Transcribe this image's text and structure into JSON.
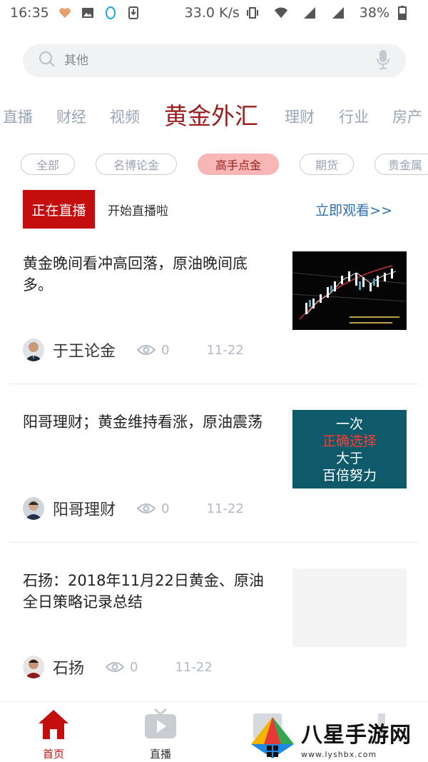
{
  "status_bar": {
    "time": "16:35",
    "speed": "33.0 K/s",
    "battery": "38%"
  },
  "search": {
    "placeholder": "其他"
  },
  "categories": [
    "直播",
    "财经",
    "视频",
    "黄金外汇",
    "理财",
    "行业",
    "房产"
  ],
  "active_category": "黄金外汇",
  "tags": [
    "全部",
    "名博论金",
    "高手点金",
    "期货",
    "贵金属"
  ],
  "active_tag": "高手点金",
  "live": {
    "badge": "正在直播",
    "text": "开始直播啦",
    "link": "立即观看>>"
  },
  "articles": [
    {
      "title": "黄金晚间看冲高回落，原油晚间底多。",
      "author": "于王论金",
      "views": "0",
      "date": "11-22",
      "thumb": "chart"
    },
    {
      "title": "阳哥理财；黄金维持看涨，原油震荡",
      "author": "阳哥理财",
      "views": "0",
      "date": "11-22",
      "thumb": "text",
      "thumb_lines": [
        "一次",
        "正确选择",
        "大于",
        "百倍努力"
      ]
    },
    {
      "title": "石扬：2018年11月22日黄金、原油全日策略记录总结",
      "author": "石扬",
      "views": "0",
      "date": "11-22",
      "thumb": "blank"
    }
  ],
  "tab_bar": {
    "home_label": "首页",
    "live_label": "直播"
  },
  "watermark": {
    "title": "八星手游网",
    "url": "www.lyshbx.com"
  },
  "colors": {
    "accent": "#c40d0d",
    "active_category": "#9b1e1e",
    "link": "#2d6fb4",
    "muted": "#9aa6b6"
  }
}
